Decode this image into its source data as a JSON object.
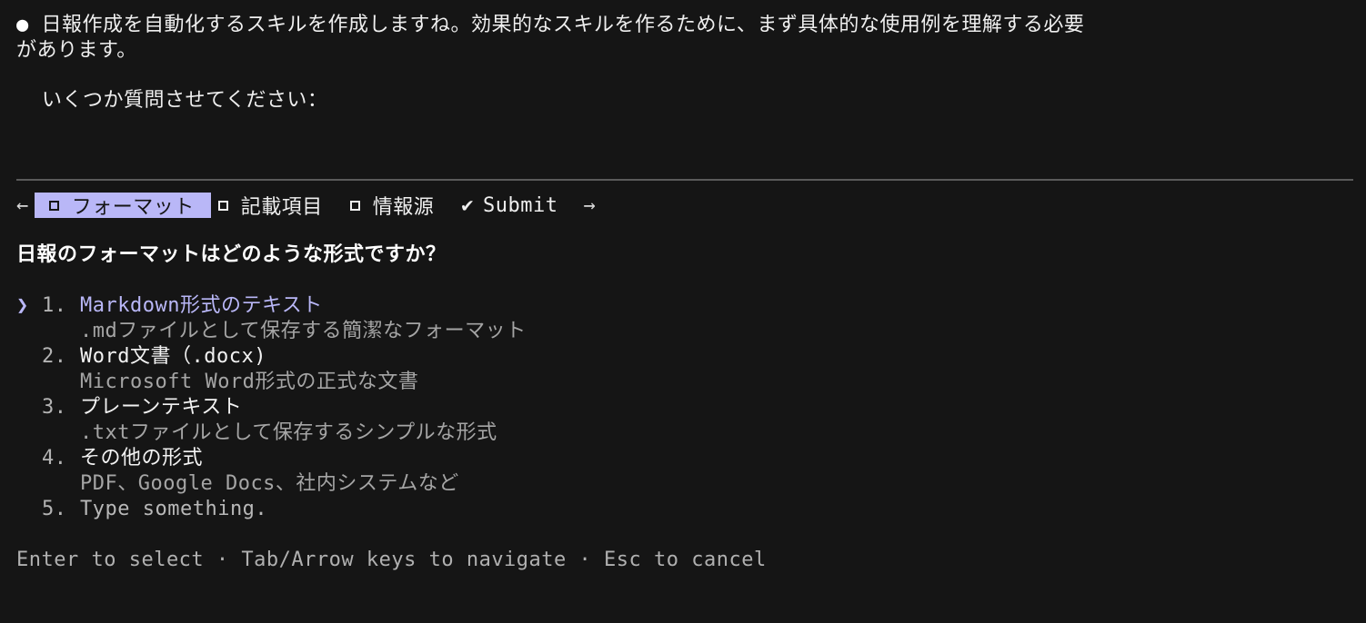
{
  "assistant": {
    "bullet": "●",
    "message_line1": "日報作成を自動化するスキルを作成しますね。効果的なスキルを作るために、まず具体的な使用例を理解する必要",
    "message_line2": "があります。",
    "prompt": "いくつか質問させてください："
  },
  "tabs": {
    "left_arrow": "←",
    "right_arrow": "→",
    "items": [
      {
        "label": "フォーマット",
        "active": true
      },
      {
        "label": "記載項目",
        "active": false
      },
      {
        "label": "情報源",
        "active": false
      }
    ],
    "submit_check": "✔",
    "submit_label": "Submit"
  },
  "question": "日報のフォーマットはどのような形式ですか？",
  "options": {
    "cursor": "❯",
    "items": [
      {
        "number": "1.",
        "label": "Markdown形式のテキスト",
        "description": ".mdファイルとして保存する簡潔なフォーマット",
        "selected": true
      },
      {
        "number": "2.",
        "label": "Word文書（.docx)",
        "description": "Microsoft Word形式の正式な文書",
        "selected": false
      },
      {
        "number": "3.",
        "label": "プレーンテキスト",
        "description": ".txtファイルとして保存するシンプルな形式",
        "selected": false
      },
      {
        "number": "4.",
        "label": "その他の形式",
        "description": "PDF、Google Docs、社内システムなど",
        "selected": false
      },
      {
        "number": "5.",
        "label": "Type something.",
        "description": "",
        "selected": false
      }
    ]
  },
  "footer": "Enter to select · Tab/Arrow keys to navigate · Esc to cancel",
  "colors": {
    "background": "#151515",
    "accent": "#b9b7f7",
    "muted": "#a5a5a5"
  }
}
